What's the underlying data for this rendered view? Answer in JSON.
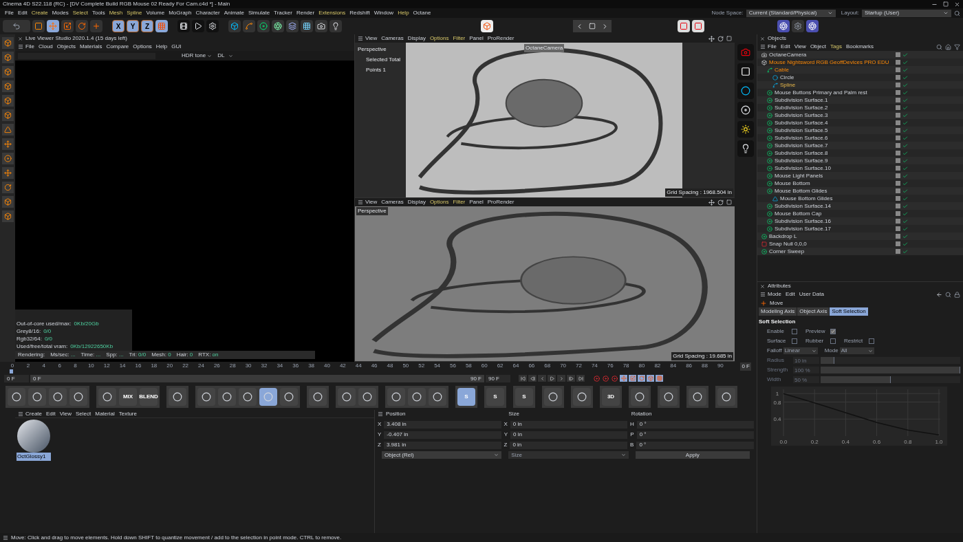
{
  "window": {
    "title": "Cinema 4D S22.118 (RC) - [DV Complete Build RGB Mouse 02 Ready For Cam.c4d *] - Main"
  },
  "menu": [
    {
      "label": "File",
      "highlighted": false
    },
    {
      "label": "Edit",
      "highlighted": false
    },
    {
      "label": "Create",
      "highlighted": true
    },
    {
      "label": "Modes",
      "highlighted": false
    },
    {
      "label": "Select",
      "highlighted": true
    },
    {
      "label": "Tools",
      "highlighted": false
    },
    {
      "label": "Mesh",
      "highlighted": true
    },
    {
      "label": "Spline",
      "highlighted": true
    },
    {
      "label": "Volume",
      "highlighted": false
    },
    {
      "label": "MoGraph",
      "highlighted": false
    },
    {
      "label": "Character",
      "highlighted": false
    },
    {
      "label": "Animate",
      "highlighted": false
    },
    {
      "label": "Simulate",
      "highlighted": false
    },
    {
      "label": "Tracker",
      "highlighted": false
    },
    {
      "label": "Render",
      "highlighted": false
    },
    {
      "label": "Extensions",
      "highlighted": true
    },
    {
      "label": "Redshift",
      "highlighted": false
    },
    {
      "label": "Window",
      "highlighted": false
    },
    {
      "label": "Help",
      "highlighted": true
    },
    {
      "label": "Octane",
      "highlighted": false
    }
  ],
  "node_space": {
    "label": "Node Space:",
    "value": "Current (Standard/Physical)"
  },
  "layout": {
    "label": "Layout:",
    "value": "Startup (User)"
  },
  "axis_buttons": [
    {
      "label": "X",
      "selected": true
    },
    {
      "label": "Y",
      "selected": true
    },
    {
      "label": "Z",
      "selected": true
    }
  ],
  "live_viewer": {
    "title": "Live Viewer Studio 2020.1.4 (15 days left)",
    "menu": [
      "File",
      "Cloud",
      "Objects",
      "Materials",
      "Compare",
      "Options",
      "Help",
      "GUI"
    ],
    "tone": "HDR tone",
    "mode": "DL",
    "stats": [
      {
        "label": "Out-of-core used/max:",
        "value": "0Kb/20Gb"
      },
      {
        "label": "Grey8/16:",
        "value": "0/0"
      },
      {
        "label": "Rgb32/64:",
        "value": "0/0"
      },
      {
        "label": "Used/free/total vram:",
        "value": "0Kb/12922650Kb"
      }
    ],
    "render_stats": [
      {
        "label": "Rendering:"
      },
      {
        "label": "Ms/sec:",
        "value": "..."
      },
      {
        "label": "Time:",
        "value": "..."
      },
      {
        "label": "Spp:",
        "value": "..."
      },
      {
        "label": "Tri:",
        "value": "0/0"
      },
      {
        "label": "Mesh:",
        "value": "0"
      },
      {
        "label": "Hair:",
        "value": "0"
      },
      {
        "label": "RTX:",
        "value": "on"
      }
    ]
  },
  "viewports": [
    {
      "menu": [
        {
          "label": "View",
          "highlighted": false
        },
        {
          "label": "Cameras",
          "highlighted": false
        },
        {
          "label": "Display",
          "highlighted": false
        },
        {
          "label": "Options",
          "highlighted": true
        },
        {
          "label": "Filter",
          "highlighted": true
        },
        {
          "label": "Panel",
          "highlighted": false
        },
        {
          "label": "ProRender",
          "highlighted": false
        }
      ],
      "view_name": "Perspective",
      "info": [
        "Selected Total",
        "Points 1"
      ],
      "camera_tag": "OctaneCamera",
      "grid_spacing": "Grid Spacing : 1968.504 in",
      "framed": true
    },
    {
      "menu": [
        {
          "label": "View",
          "highlighted": false
        },
        {
          "label": "Cameras",
          "highlighted": false
        },
        {
          "label": "Display",
          "highlighted": false
        },
        {
          "label": "Options",
          "highlighted": true
        },
        {
          "label": "Filter",
          "highlighted": true
        },
        {
          "label": "Panel",
          "highlighted": false
        },
        {
          "label": "ProRender",
          "highlighted": false
        }
      ],
      "view_name": "Perspective",
      "grid_spacing": "Grid Spacing : 19.685 in",
      "framed": false
    }
  ],
  "timeline": {
    "ticks": [
      "0",
      "2",
      "4",
      "6",
      "8",
      "10",
      "12",
      "14",
      "16",
      "18",
      "20",
      "22",
      "24",
      "26",
      "28",
      "30",
      "32",
      "34",
      "36",
      "38",
      "40",
      "42",
      "44",
      "46",
      "48",
      "50",
      "52",
      "54",
      "56",
      "58",
      "60",
      "62",
      "64",
      "66",
      "68",
      "70",
      "72",
      "74",
      "76",
      "78",
      "80",
      "82",
      "84",
      "86",
      "88",
      "90"
    ],
    "level": 0,
    "frame_display": "0 F",
    "start": "0 F",
    "range": {
      "start": "0 F",
      "end": "90 F",
      "level": 1
    },
    "end": "90 F"
  },
  "material_toolbar": [
    [
      {
        "selected": false
      },
      {
        "selected": false
      },
      {
        "selected": false
      },
      {
        "selected": false
      }
    ],
    [
      {
        "selected": false
      },
      {
        "label": "MIX",
        "selected": false
      },
      {
        "label": "BLEND",
        "selected": false
      }
    ],
    [
      {
        "selected": false
      }
    ],
    [
      {
        "selected": false
      },
      {
        "selected": false
      },
      {
        "selected": false
      },
      {
        "selected": true
      },
      {
        "selected": false
      }
    ],
    [
      {
        "selected": false
      }
    ],
    [
      {
        "selected": false
      },
      {
        "selected": false
      }
    ],
    [
      {
        "selected": false
      },
      {
        "selected": false
      },
      {
        "selected": false
      }
    ],
    [
      {
        "label": "S",
        "selected": true
      }
    ],
    [
      {
        "label": "S",
        "selected": false
      }
    ],
    [
      {
        "label": "S",
        "selected": false
      }
    ],
    [
      {
        "selected": false
      }
    ],
    [
      {
        "selected": false
      }
    ],
    [
      {
        "label": "3D",
        "selected": false
      }
    ],
    [
      {
        "selected": false
      }
    ],
    [
      {
        "selected": false
      }
    ],
    [
      {
        "selected": false
      }
    ],
    [
      {
        "selected": false
      }
    ]
  ],
  "material_manager": {
    "menu": [
      "Create",
      "Edit",
      "View",
      "Select",
      "Material",
      "Texture"
    ],
    "materials": [
      {
        "name": "OctGlossy1",
        "selected": true
      }
    ]
  },
  "coordinates": {
    "headers": [
      "Position",
      "Size",
      "Rotation"
    ],
    "rows": [
      {
        "axis": "X",
        "position": "3.408 in",
        "size_axis": "X",
        "size": "0 in",
        "rot_axis": "H",
        "rotation": "0 °"
      },
      {
        "axis": "Y",
        "position": "-0.407 in",
        "size_axis": "Y",
        "size": "0 in",
        "rot_axis": "P",
        "rotation": "0 °"
      },
      {
        "axis": "Z",
        "position": "3.981 in",
        "size_axis": "Z",
        "size": "0 in",
        "rot_axis": "B",
        "rotation": "0 °"
      }
    ],
    "mode": "Object (Rel)",
    "size_mode": "Size",
    "apply": "Apply"
  },
  "objects": {
    "title": "Objects",
    "menu": [
      {
        "label": "File",
        "highlighted": false
      },
      {
        "label": "Edit",
        "highlighted": false
      },
      {
        "label": "View",
        "highlighted": false
      },
      {
        "label": "Object",
        "highlighted": false
      },
      {
        "label": "Tags",
        "highlighted": true
      },
      {
        "label": "Bookmarks",
        "highlighted": false
      }
    ],
    "items": [
      {
        "name": "OctaneCamera",
        "kind": "camera",
        "selected": false
      },
      {
        "name": "Mouse Nightsword RGB GeoffDevices PRO EDU",
        "kind": "null",
        "selected": true,
        "children": [
          {
            "name": "Cable",
            "kind": "sweep",
            "selected": true,
            "children": [
              {
                "name": "Circle",
                "kind": "circle",
                "selected": false
              },
              {
                "name": "Spline",
                "kind": "spline",
                "selected": true
              }
            ]
          },
          {
            "name": "Mouse Buttons Primary and Palm rest",
            "kind": "subdivision",
            "selected": false
          },
          {
            "name": "Subdivision Surface.1",
            "kind": "subdivision",
            "selected": false
          },
          {
            "name": "Subdivision Surface.2",
            "kind": "subdivision",
            "selected": false
          },
          {
            "name": "Subdivision Surface.3",
            "kind": "subdivision",
            "selected": false
          },
          {
            "name": "Subdivision Surface.4",
            "kind": "subdivision",
            "selected": false
          },
          {
            "name": "Subdivision Surface.5",
            "kind": "subdivision",
            "selected": false
          },
          {
            "name": "Subdivision Surface.6",
            "kind": "subdivision",
            "selected": false
          },
          {
            "name": "Subdivision Surface.7",
            "kind": "subdivision",
            "selected": false
          },
          {
            "name": "Subdivision Surface.8",
            "kind": "subdivision",
            "selected": false
          },
          {
            "name": "Subdivision Surface.9",
            "kind": "subdivision",
            "selected": false
          },
          {
            "name": "Subdivision Surface.10",
            "kind": "subdivision",
            "selected": false
          },
          {
            "name": "Mouse Light Panels",
            "kind": "subdivision",
            "selected": false
          },
          {
            "name": "Mouse Bottom",
            "kind": "subdivision",
            "selected": false
          },
          {
            "name": "Mouse Bottom Glides",
            "kind": "subdivision",
            "selected": false,
            "children": [
              {
                "name": "Mouse Bottom Glides",
                "kind": "polygon",
                "selected": false
              }
            ]
          },
          {
            "name": "Subdivision Surface.14",
            "kind": "subdivision",
            "selected": false
          },
          {
            "name": "Mouse Bottom Cap",
            "kind": "subdivision",
            "selected": false
          },
          {
            "name": "Subdivision Surface.16",
            "kind": "subdivision",
            "selected": false
          },
          {
            "name": "Subdivision Surface.17",
            "kind": "subdivision",
            "selected": false
          }
        ]
      },
      {
        "name": "Backdrop L",
        "kind": "subdivision",
        "selected": false
      },
      {
        "name": "Snap Null 0,0,0",
        "kind": "snap",
        "selected": false
      },
      {
        "name": "Corner Sweep",
        "kind": "subdivision",
        "selected": false
      }
    ]
  },
  "attributes": {
    "title": "Attributes",
    "menu": [
      "Mode",
      "Edit",
      "User Data"
    ],
    "tool": "Move",
    "tabs": [
      {
        "label": "Modeling Axis",
        "selected": false
      },
      {
        "label": "Object Axis",
        "selected": false
      },
      {
        "label": "Soft Selection",
        "selected": true
      }
    ],
    "section": "Soft Selection",
    "checks": [
      [
        {
          "label": "Enable",
          "checked": false
        },
        {
          "label": "Preview",
          "checked": true
        }
      ],
      [
        {
          "label": "Surface",
          "checked": false
        },
        {
          "label": "Rubber",
          "checked": false
        },
        {
          "label": "Restrict",
          "checked": false
        }
      ]
    ],
    "dropdowns": [
      {
        "label": "Falloff",
        "value": "Linear"
      },
      {
        "label": "Mode",
        "value": "All"
      }
    ],
    "sliders": [
      {
        "label": "Radius",
        "value": "10 in",
        "level": 0.1,
        "disabled": true
      },
      {
        "label": "Strength",
        "value": "100 %",
        "level": 1,
        "disabled": true
      },
      {
        "label": "Width",
        "value": "50 %",
        "level": 0.5,
        "disabled": true
      }
    ],
    "chart_data": {
      "type": "line",
      "x": [
        0,
        0.2,
        0.4,
        0.6,
        0.8,
        1.0
      ],
      "grid": true,
      "series": [
        {
          "color": "#111111",
          "values": [
            1.0,
            0.78,
            0.55,
            0.32,
            0.14,
            0.03
          ]
        }
      ],
      "xlim": [
        0,
        1
      ],
      "ylim": [
        0,
        1.1
      ],
      "xticks": [
        {
          "value": 0,
          "label": "0.0"
        },
        {
          "value": 0.2,
          "label": "0.2"
        },
        {
          "value": 0.4,
          "label": "0.4"
        },
        {
          "value": 0.6,
          "label": "0.6"
        },
        {
          "value": 0.8,
          "label": "0.8"
        },
        {
          "value": 1,
          "label": "1.0"
        }
      ],
      "yticks": [
        {
          "value": 0.4,
          "label": "0.4"
        },
        {
          "value": 0.8,
          "label": "0.8"
        },
        {
          "value": 1.0,
          "label": "1"
        }
      ]
    }
  },
  "status_bar": "Move: Click and drag to move elements. Hold down SHIFT to quantize movement / add to the selection in point mode. CTRL to remove."
}
